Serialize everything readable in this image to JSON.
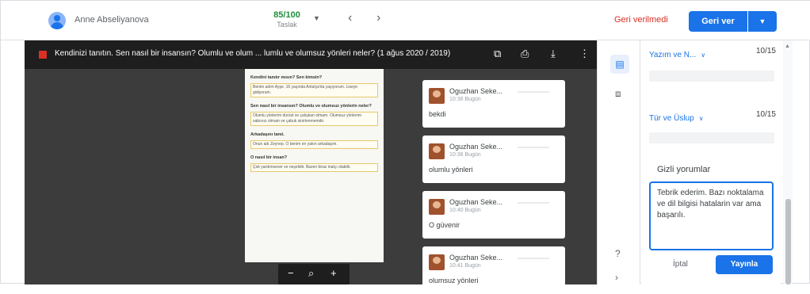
{
  "topbar": {
    "student_name": "Anne Abseliyanova",
    "grade_value": "85/100",
    "grade_status": "Taslak",
    "grade_dropdown_icon": "caret-down-icon",
    "nav_prev": "‹",
    "nav_next": "›",
    "return_link": "Geri verilmedi",
    "return_button": "Geri ver",
    "return_more": "▼"
  },
  "viewer": {
    "doc_title": "Kendinizi tanıtın. Sen nasıl bir insansın? Olumlu ve olum ... lumlu ve olumsuz yönleri neler? (1 ağus 2020 / 2019)",
    "page": [
      {
        "q": "Kendini tanıtır mısın? Sen kimsin?",
        "a": "Benim adım Ayşe. 16 yaşında Antalya'da yaşıyorum. Liseye gidiyorum."
      },
      {
        "q": "Sen nasıl bir insansın? Olumlu ve olumsuz yönlerin neler?",
        "a": "Olumlu yönlerim dürüst ve çalışkan olmam. Olumsuz yönlerim sabırsız olmam ve çabuk sinirlenmemdir."
      },
      {
        "q": "Arkadaşını tanıt.",
        "a": "Onun adı Zeynep. O benim en yakın arkadaşım."
      },
      {
        "q": "O nasıl bir insan?",
        "a": "Çok yardımsever ve neşelidir. Bazen biraz inatçı olabilir."
      }
    ],
    "zoom_out": "−",
    "zoom_icon": "search-icon",
    "zoom_in": "+"
  },
  "comments": [
    {
      "author": "Oguzhan Seke...",
      "time": "10:36 Bugün",
      "text": "bekdi"
    },
    {
      "author": "Oguzhan Seke...",
      "time": "10:38 Bugün",
      "text": "olumlu yönleri"
    },
    {
      "author": "Oguzhan Seke...",
      "time": "10:40 Bugün",
      "text": "O güvenir"
    },
    {
      "author": "Oguzhan Seke...",
      "time": "10:41 Bugün",
      "text": "olumsuz yönleri"
    }
  ],
  "panel": {
    "rubric": [
      {
        "name": "Yazım ve N...",
        "score": "10/15"
      },
      {
        "name": "Tür ve Üslup",
        "score": "10/15"
      }
    ],
    "private_comments_title": "Gizli yorumlar",
    "private_comment_text": "Tebrik ederim. Bazı noktalama ve dil bilgisi hatalarin var ama başarılı.",
    "cancel": "İptal",
    "post": "Yayınla"
  },
  "colors": {
    "accent": "#1a73e8",
    "grade": "#1e8e3e",
    "return_link": "#d93025"
  }
}
